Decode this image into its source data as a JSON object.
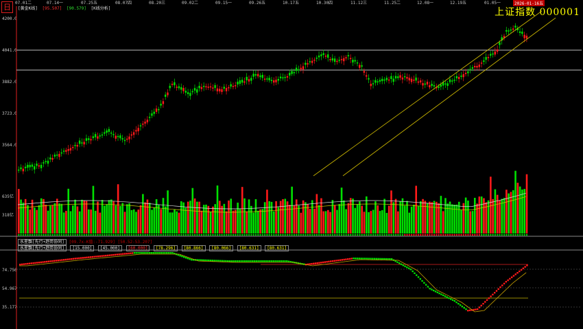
{
  "window": {
    "app_icon": "日",
    "title": "上证指数  000001",
    "selected_date": "2026-01-16五"
  },
  "header": {
    "mode": "[黄金K线]",
    "v1": "[95.507]",
    "v2": "[90.579]",
    "tab": "[K线分析]"
  },
  "dates": [
    "07.01二",
    "07.14一",
    "07.25五",
    "08.07四",
    "08.20三",
    "09.02二",
    "09.15一",
    "09.26五",
    "10.17五",
    "10.30四",
    "11.12三",
    "11.25二",
    "12.08一",
    "12.19五",
    "01.05一"
  ],
  "price_axis": [
    "4200.0",
    "4041.0",
    "3882.0",
    "3723.0",
    "3564.0"
  ],
  "volume_axis": [
    "635亿",
    "318亿"
  ],
  "indicator_axis": [
    "74.756",
    "54.967",
    "35.177"
  ],
  "indicator_header1": {
    "name": "水星飘[先行+趋势协同]",
    "values": [
      "[45.000]",
      "[60.000]",
      "[78.296]",
      "[80.866]",
      "[80.066]",
      "[80.631]",
      "[80.631]"
    ],
    "tail": "[09.7x-K值:-71.929] [50.52-53.207]"
  },
  "indicator_header2": {
    "name": "水星飘[先行+趋势协同]",
    "values": [
      "[15.000]",
      "[45.000]",
      "[60.000]",
      "[78.296]",
      "[80.866]",
      "[80.066]",
      "[80.631]",
      "[80.631]"
    ]
  },
  "colors": {
    "up": "#ff1a1a",
    "down": "#00e000",
    "channel": "#c8b400",
    "ma": "#e0e0e0",
    "accent": "#ffff00"
  }
}
